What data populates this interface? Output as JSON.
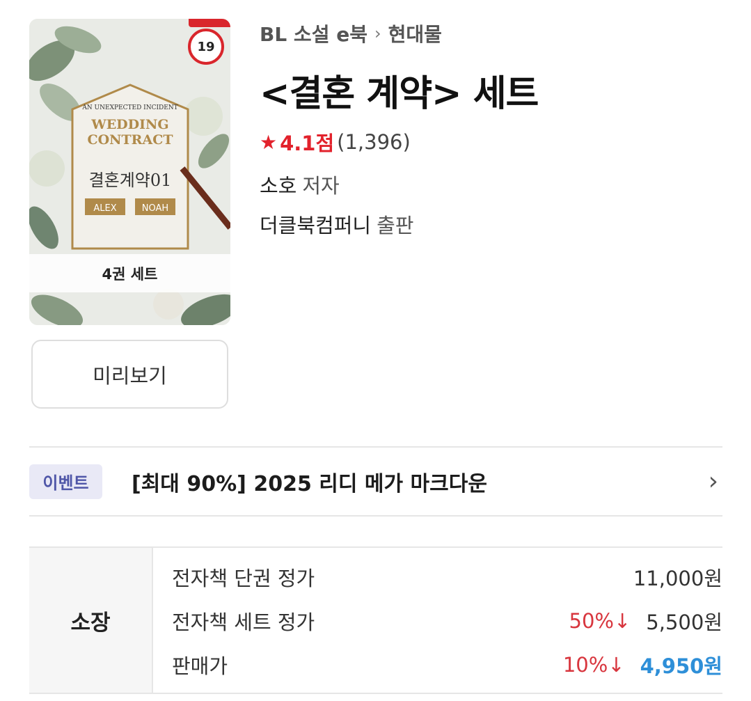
{
  "cover": {
    "age_rating": "19",
    "set_label": "4권 세트",
    "art_title_line1": "WEDDING",
    "art_title_line2": "CONTRACT",
    "art_subtitle": "AN UNEXPECTED INCIDENT",
    "art_korean_title": "결혼계약01",
    "art_name_left": "ALEX",
    "art_name_right": "NOAH"
  },
  "preview": {
    "label": "미리보기"
  },
  "breadcrumb": {
    "category": "BL 소설 e북",
    "separator": "›",
    "subcategory": "현대물"
  },
  "title": "<결혼 계약> 세트",
  "rating": {
    "score": "4.1점",
    "count": "(1,396)",
    "star_color": "#e2222c"
  },
  "author": {
    "name": "소호",
    "role": "저자"
  },
  "publisher": {
    "name": "더클북컴퍼니",
    "role": "출판"
  },
  "event": {
    "badge": "이벤트",
    "text": "[최대 90%] 2025 리디 메가 마크다운",
    "chevron": "›"
  },
  "price": {
    "section_label": "소장",
    "rows": [
      {
        "name": "전자책 단권 정가",
        "discount": "",
        "value": "11,000원"
      },
      {
        "name": "전자책 세트 정가",
        "discount": "50%↓",
        "value": "5,500원"
      },
      {
        "name": "판매가",
        "discount": "10%↓",
        "value": "4,950원"
      }
    ],
    "accent_final": "#2e8fd8",
    "discount_color": "#d8363e"
  }
}
